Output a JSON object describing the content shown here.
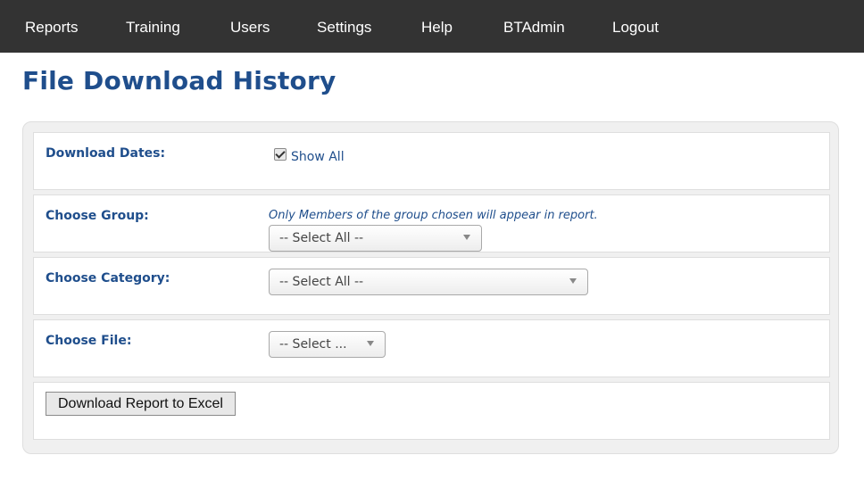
{
  "nav": {
    "items": [
      {
        "label": "Reports"
      },
      {
        "label": "Training"
      },
      {
        "label": "Users"
      },
      {
        "label": "Settings"
      },
      {
        "label": "Help"
      },
      {
        "label": "BTAdmin"
      },
      {
        "label": "Logout"
      }
    ]
  },
  "page": {
    "title": "File Download History"
  },
  "form": {
    "download_dates": {
      "label": "Download Dates:",
      "show_all_label": "Show All",
      "show_all_checked": true
    },
    "group": {
      "label": "Choose Group:",
      "hint": "Only Members of the group chosen will appear in report.",
      "selected": "-- Select All --"
    },
    "category": {
      "label": "Choose Category:",
      "selected": "-- Select All --"
    },
    "file": {
      "label": "Choose File:",
      "selected": "-- Select ..."
    },
    "export_button": "Download Report to Excel"
  },
  "colors": {
    "nav_bg": "#333333",
    "accent": "#1f4e8c",
    "panel_bg": "#f0f0f0"
  },
  "icons": {
    "dropdown": "chevron-down-icon",
    "checkbox": "checkmark-icon"
  }
}
